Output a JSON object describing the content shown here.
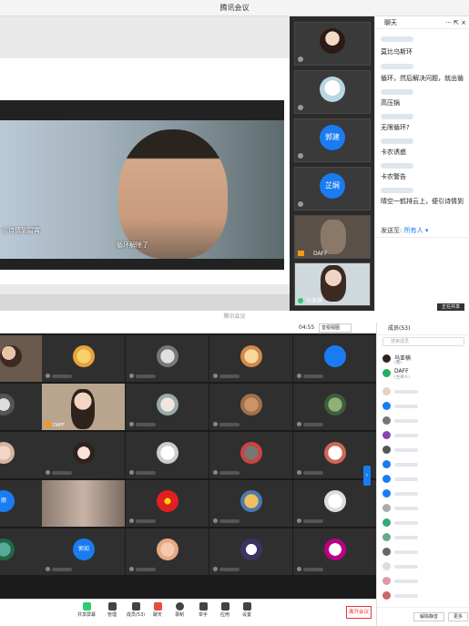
{
  "top_window": {
    "title": "腾讯会议",
    "movie_subtitle_left": "引诗情到碧霄",
    "movie_subtitle_center": "循环解除了",
    "participants": [
      {
        "kind": "avatar",
        "label": ""
      },
      {
        "kind": "avatar",
        "label": ""
      },
      {
        "kind": "name",
        "label": "郭建"
      },
      {
        "kind": "name",
        "label": "芷娴"
      },
      {
        "kind": "video",
        "label": "DAFF"
      },
      {
        "kind": "video",
        "label": "马亚楠"
      }
    ],
    "chat": {
      "title": "聊天",
      "icons": "··· ⇱ ×",
      "messages": [
        "莫比乌斯环",
        "循环，然后解决问题，就出循",
        "高压锅",
        "无限循环?",
        "卡农诱惑",
        "卡农警告",
        "晴空一鹤排云上，便引诗情到"
      ],
      "send_to_label": "发送至:",
      "send_to_value": "所有人 ▾",
      "send_button": "正在共享"
    }
  },
  "bottom_window": {
    "title": "腾讯会议",
    "timer": "04:55",
    "view_button": "音视视图",
    "cells": [
      {
        "type": "photo"
      },
      {
        "type": "avatar"
      },
      {
        "type": "avatar"
      },
      {
        "type": "avatar"
      },
      {
        "type": "avatar"
      },
      {
        "type": "photo"
      },
      {
        "type": "video",
        "label": "DAFF"
      },
      {
        "type": "avatar"
      },
      {
        "type": "avatar"
      },
      {
        "type": "avatar"
      },
      {
        "type": "photo"
      },
      {
        "type": "avatar"
      },
      {
        "type": "avatar"
      },
      {
        "type": "avatar"
      },
      {
        "type": "avatar"
      },
      {
        "type": "name",
        "label": "丽"
      },
      {
        "type": "blur"
      },
      {
        "type": "avatar"
      },
      {
        "type": "avatar"
      },
      {
        "type": "avatar"
      },
      {
        "type": "photo"
      },
      {
        "type": "name",
        "label": "郭如"
      },
      {
        "type": "avatar"
      },
      {
        "type": "avatar"
      },
      {
        "type": "avatar"
      }
    ],
    "toolbar": [
      {
        "label": "共享屏幕"
      },
      {
        "label": "管理"
      },
      {
        "label": "成员(53)"
      },
      {
        "label": "聊天"
      },
      {
        "label": "录制"
      },
      {
        "label": "举手"
      },
      {
        "label": "应用"
      },
      {
        "label": "设置"
      }
    ],
    "leave_button": "离开会议",
    "members_panel": {
      "title": "成员(53)",
      "search_placeholder": "搜索成员",
      "host": {
        "name": "马亚楠",
        "role": "(我)"
      },
      "cohost": {
        "name": "DAFF",
        "role": "(主持人)"
      },
      "footer_left": "解除静音",
      "footer_right": "更多"
    }
  }
}
